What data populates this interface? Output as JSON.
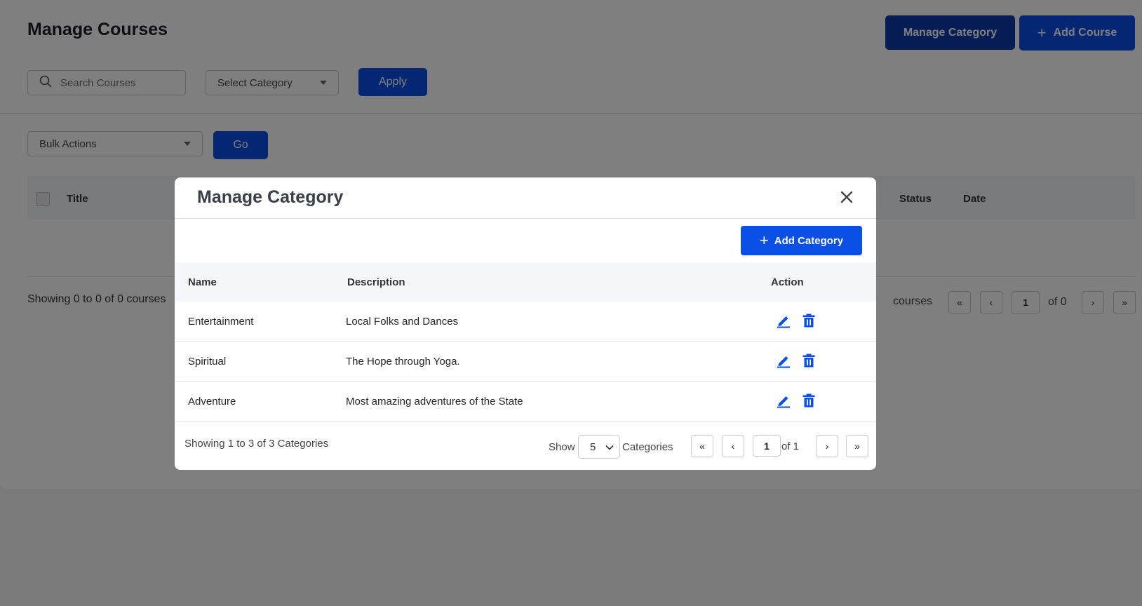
{
  "page": {
    "title": "Manage Courses",
    "manage_category_label": "Manage Category",
    "add_course_label": "Add Course",
    "search_placeholder": "Search Courses",
    "category_select_value": "Select Category",
    "apply_label": "Apply",
    "bulk_select_value": "Bulk Actions",
    "go_label": "Go",
    "table_headers": {
      "title": "Title",
      "status": "Status",
      "date": "Date"
    },
    "showing_text": "Showing 0 to 0 of 0 courses",
    "pagination": {
      "per_page_label": "courses",
      "first": "«",
      "prev": "‹",
      "current": "1",
      "of_text": "of 0",
      "next": "›",
      "last": "»"
    }
  },
  "modal": {
    "title": "Manage Category",
    "add_label": "Add Category",
    "headers": {
      "name": "Name",
      "description": "Description",
      "action": "Action"
    },
    "rows": [
      {
        "name": "Entertainment",
        "description": "Local Folks and Dances"
      },
      {
        "name": "Spiritual",
        "description": "The Hope through Yoga."
      },
      {
        "name": "Adventure",
        "description": "Most amazing adventures of the State"
      }
    ],
    "showing_text": "Showing 1 to 3 of 3 Categories",
    "show_label": "Show",
    "per_page_value": "5",
    "per_page_suffix": "Categories",
    "pagination": {
      "first": "«",
      "prev": "‹",
      "current": "1",
      "of_text": "of 1",
      "next": "›",
      "last": "»"
    }
  },
  "colors": {
    "accent": "#0a4fe6",
    "accent_dark": "#0b3aa8",
    "icon_blue": "#0a4fe6"
  },
  "icons": {
    "search": "search-icon",
    "close": "close-icon",
    "edit": "pencil-icon",
    "delete": "trash-icon",
    "plus": "plus-icon"
  }
}
